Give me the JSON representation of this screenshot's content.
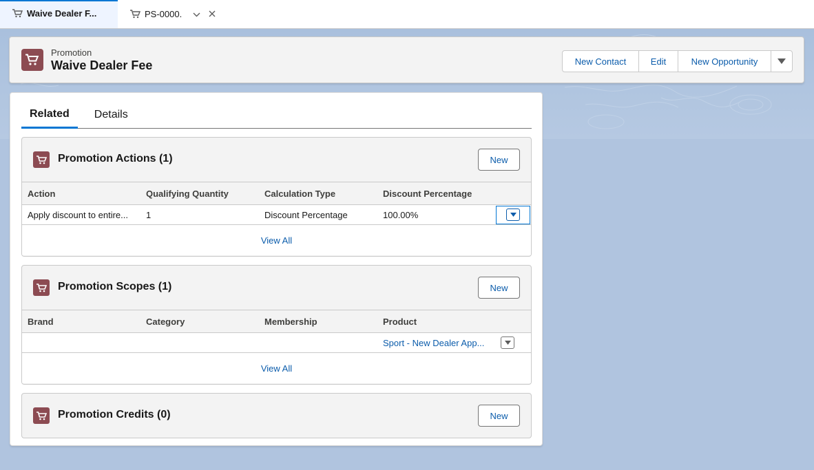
{
  "tabs": [
    {
      "label": "Waive Dealer F...",
      "icon": "cart-icon",
      "active": true
    },
    {
      "label": "PS-0000...",
      "icon": "cart-icon",
      "active": false
    }
  ],
  "header": {
    "object_label": "Promotion",
    "record_title": "Waive Dealer Fee",
    "icon": "cart-icon",
    "icon_color": "#8c4b52",
    "buttons": {
      "new_contact": "New Contact",
      "edit": "Edit",
      "new_opportunity": "New Opportunity"
    }
  },
  "record_tabs": {
    "related": "Related",
    "details": "Details"
  },
  "sections": {
    "actions": {
      "title": "Promotion Actions (1)",
      "new_label": "New",
      "columns": [
        "Action",
        "Qualifying Quantity",
        "Calculation Type",
        "Discount Percentage"
      ],
      "rows": [
        [
          "Apply discount to entire...",
          "1",
          "Discount Percentage",
          "100.00%"
        ]
      ],
      "view_all": "View All"
    },
    "scopes": {
      "title": "Promotion Scopes (1)",
      "new_label": "New",
      "columns": [
        "Brand",
        "Category",
        "Membership",
        "Product"
      ],
      "rows": [
        [
          "",
          "",
          "",
          "Sport - New Dealer App..."
        ]
      ],
      "view_all": "View All"
    },
    "credits": {
      "title": "Promotion Credits (0)",
      "new_label": "New"
    }
  },
  "colors": {
    "brand_link": "#0b5cab",
    "active_tab_indicator": "#0176d3",
    "object_icon": "#8c4b52",
    "page_background": "#b0c4df"
  }
}
